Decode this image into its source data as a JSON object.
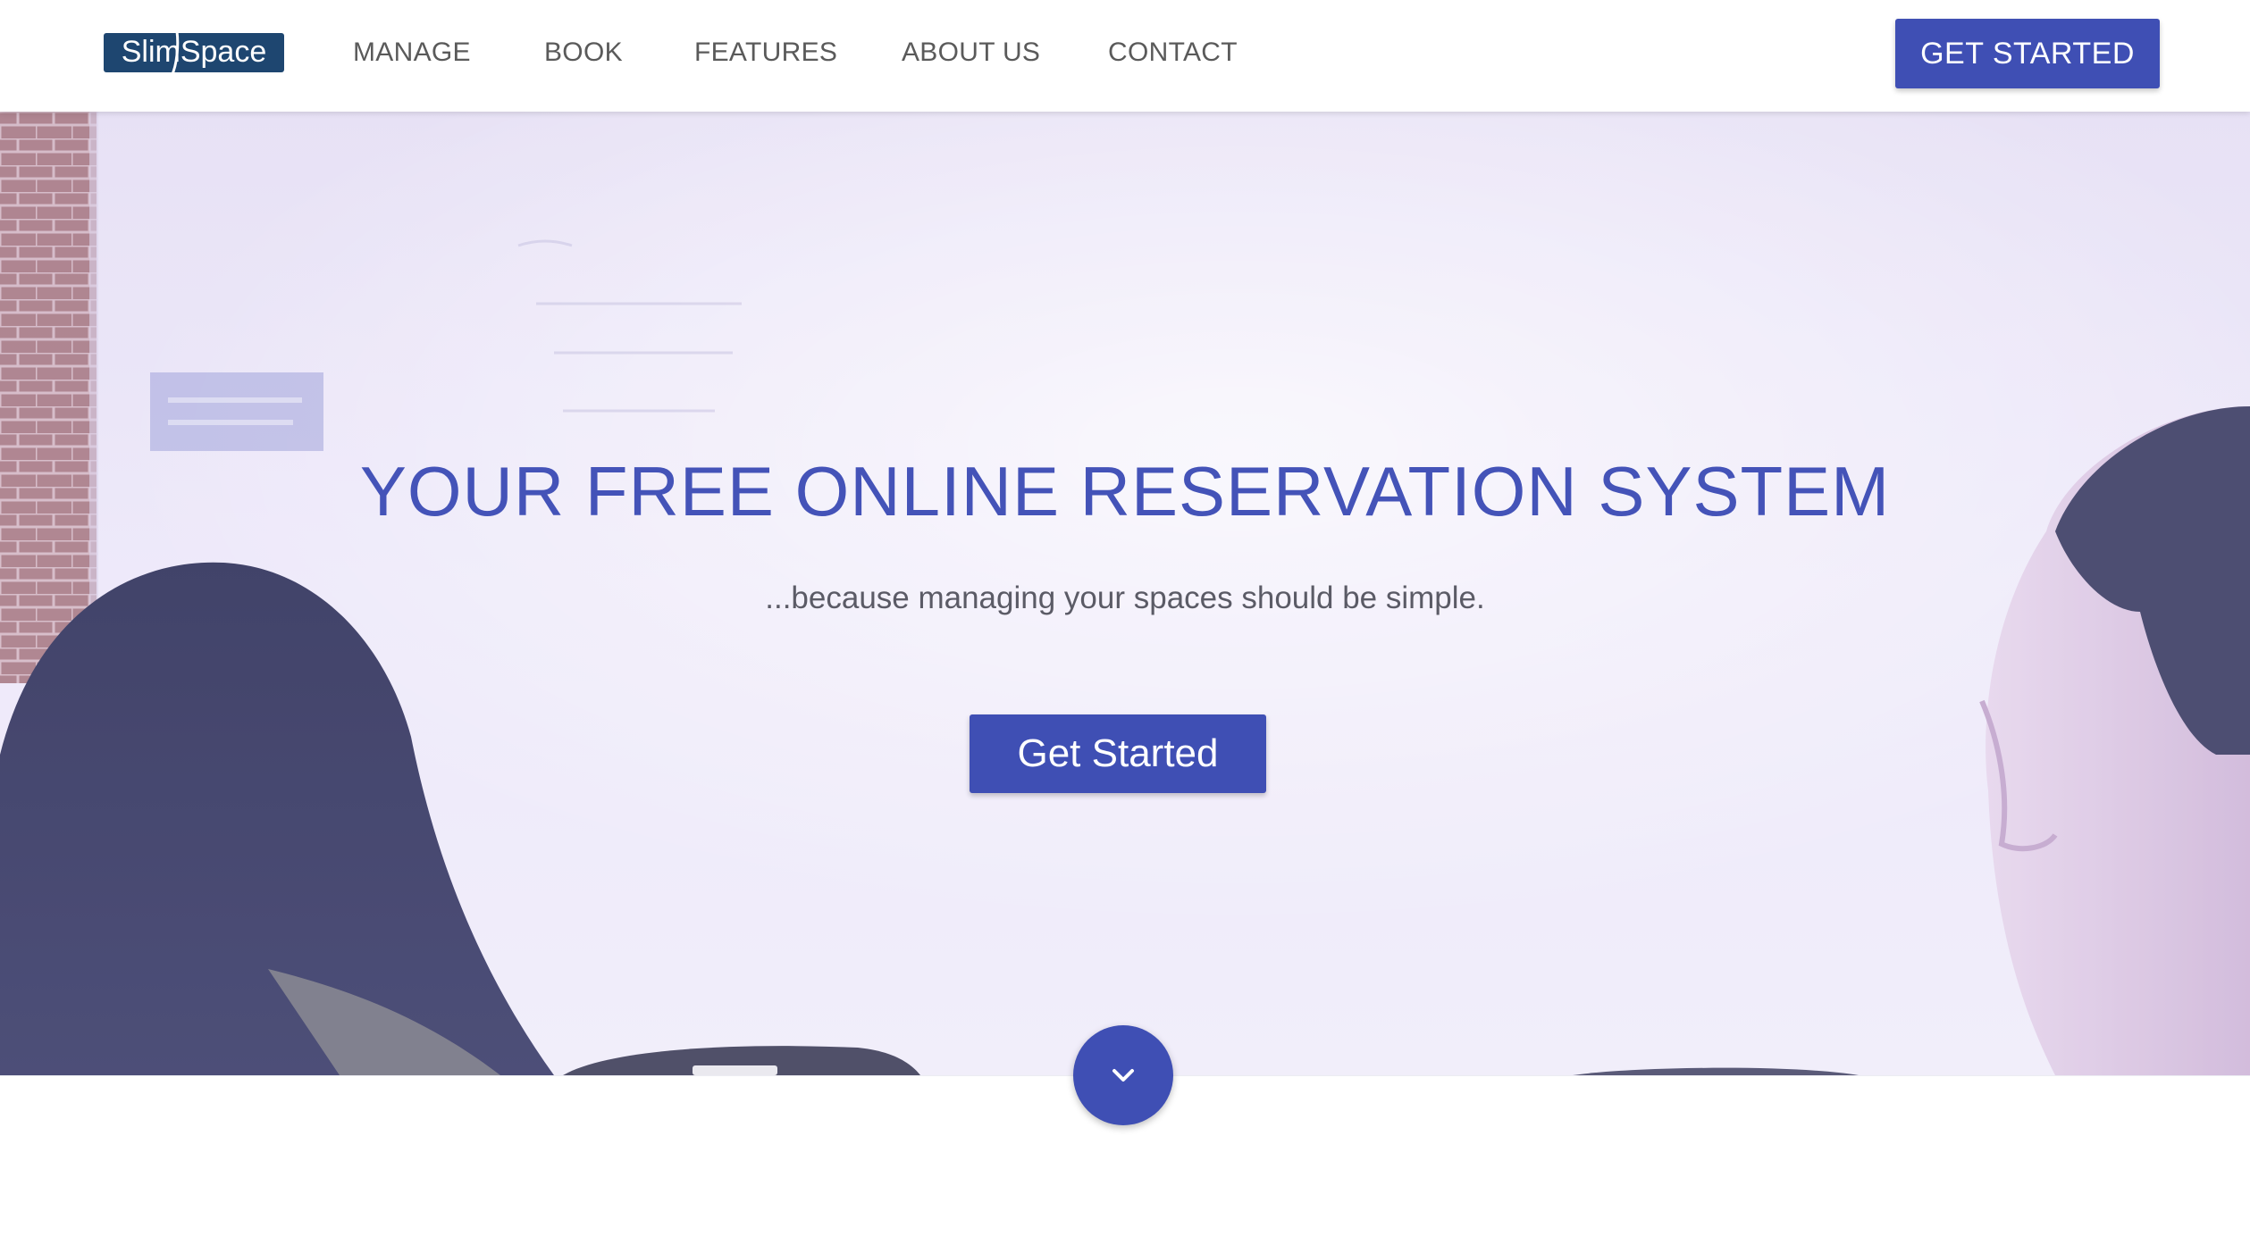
{
  "header": {
    "logo_text": "SlimSpace",
    "nav": [
      {
        "label": "MANAGE"
      },
      {
        "label": "BOOK"
      },
      {
        "label": "FEATURES"
      },
      {
        "label": "ABOUT US"
      },
      {
        "label": "CONTACT"
      }
    ],
    "cta_label": "GET STARTED"
  },
  "hero": {
    "title": "YOUR FREE ONLINE RESERVATION SYSTEM",
    "subtitle": "...because managing your spaces should be simple.",
    "cta_label": "Get Started",
    "scroll_icon": "chevron-down-icon"
  },
  "colors": {
    "primary": "#3f4fb4",
    "title": "#4453b8",
    "nav_text": "#5a5a5a",
    "logo_bg": "#1e4670"
  }
}
